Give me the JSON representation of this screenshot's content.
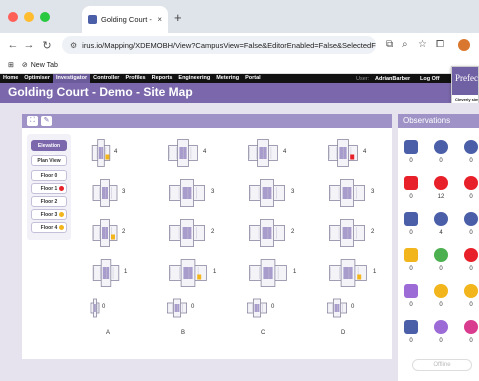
{
  "browser": {
    "tab_title": "Golding Court - Demo - Site",
    "tab_close": "×",
    "new_tab_plus": "+",
    "url": "irus.io/Mapping/XDEMOBH/View?CampusView=False&EditorEnabled=False&SelectedFloor=&Mo...",
    "bookmark_label": "New Tab"
  },
  "nav": {
    "items": [
      "Home",
      "Optimiser",
      "Investigator",
      "Controller",
      "Profiles",
      "Reports",
      "Engineering",
      "Metering",
      "Portal"
    ],
    "active": "Investigator",
    "user_label": "User:",
    "user_name": "AdrianBarber",
    "logoff": "Log Off"
  },
  "page_title": "Golding Court - Demo - Site Map",
  "promo": {
    "heading": "Prefect",
    "sub1": "Cleverly sim",
    "sub2": "control of en"
  },
  "views": {
    "elevation": "Elevation View",
    "plan": "Plan View",
    "floors": [
      "Floor 0",
      "Floor 1",
      "Floor 2",
      "Floor 3",
      "Floor 4"
    ]
  },
  "floor_indicators": {
    "Floor 1": "#e8202a",
    "Floor 3": "#f2b51b",
    "Floor 4": "#f2b51b"
  },
  "columns": [
    "A",
    "B",
    "C",
    "D"
  ],
  "floor_numbers": [
    "4",
    "3",
    "2",
    "1",
    "0"
  ],
  "observations": {
    "title": "Observations",
    "values": [
      "0",
      "0",
      "0",
      "0",
      "12",
      "0",
      "0",
      "4",
      "0",
      "0",
      "0",
      "0",
      "0",
      "0",
      "0",
      "0",
      "0",
      "0"
    ],
    "offline": "Offline"
  },
  "colors": {
    "accent": "#7b68ac",
    "header": "#9f92c6",
    "alarm": "#e8202a",
    "warning": "#f2b51b"
  }
}
